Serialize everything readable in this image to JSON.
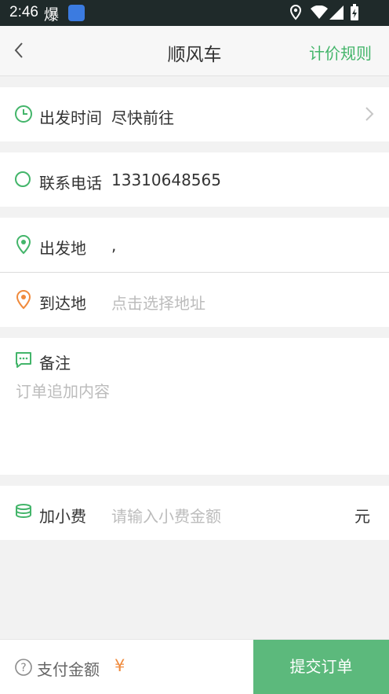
{
  "status": {
    "time": "2:46",
    "baozi_char": "爆"
  },
  "header": {
    "title": "顺风车",
    "pricing_rule": "计价规则"
  },
  "departure_time": {
    "label": "出发时间",
    "value": "尽快前往"
  },
  "phone": {
    "label": "联系电话",
    "value": "13310648565"
  },
  "origin": {
    "label": "出发地",
    "value": ","
  },
  "destination": {
    "label": "到达地",
    "placeholder": "点击选择地址"
  },
  "remark": {
    "label": "备注",
    "placeholder": "订单追加内容"
  },
  "tip": {
    "label": "加小费",
    "placeholder": "请输入小费金额",
    "unit": "元"
  },
  "footer": {
    "pay_label": "支付金额",
    "currency": "¥",
    "submit": "提交订单"
  },
  "colors": {
    "accent": "#43b56a",
    "orange": "#f08a3c",
    "submit_bg": "#5cb97c"
  }
}
